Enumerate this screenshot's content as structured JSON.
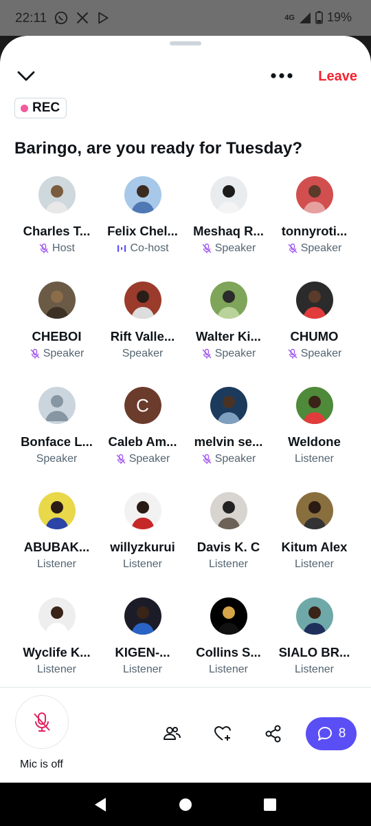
{
  "status_bar": {
    "time": "22:11",
    "network": "4G",
    "battery": "19%"
  },
  "header": {
    "leave_label": "Leave"
  },
  "rec_badge": {
    "label": "REC"
  },
  "space_title": "Baringo, are you ready for Tuesday?",
  "participants": [
    {
      "name": "Charles T...",
      "role": "Host",
      "status": "muted"
    },
    {
      "name": "Felix Chel...",
      "role": "Co-host",
      "status": "speaking"
    },
    {
      "name": "Meshaq R...",
      "role": "Speaker",
      "status": "muted"
    },
    {
      "name": "tonnyroti...",
      "role": "Speaker",
      "status": "muted"
    },
    {
      "name": "CHEBOI",
      "role": "Speaker",
      "status": "muted"
    },
    {
      "name": "Rift Valle...",
      "role": "Speaker",
      "status": "none"
    },
    {
      "name": "Walter Ki...",
      "role": "Speaker",
      "status": "muted"
    },
    {
      "name": "CHUMO",
      "role": "Speaker",
      "status": "muted"
    },
    {
      "name": "Bonface L...",
      "role": "Speaker",
      "status": "none"
    },
    {
      "name": "Caleb Am...",
      "role": "Speaker",
      "status": "muted",
      "avatar_letter": "C"
    },
    {
      "name": "melvin se...",
      "role": "Speaker",
      "status": "muted"
    },
    {
      "name": "Weldone",
      "role": "Listener",
      "status": "none"
    },
    {
      "name": "ABUBAK...",
      "role": "Listener",
      "status": "none"
    },
    {
      "name": "willyzkurui",
      "role": "Listener",
      "status": "none"
    },
    {
      "name": "Davis K. C",
      "role": "Listener",
      "status": "none"
    },
    {
      "name": "Kitum Alex",
      "role": "Listener",
      "status": "none"
    },
    {
      "name": "Wyclife K...",
      "role": "Listener",
      "status": "none"
    },
    {
      "name": "KIGEN-...",
      "role": "Listener",
      "status": "none"
    },
    {
      "name": "Collins S...",
      "role": "Listener",
      "status": "none"
    },
    {
      "name": "SIALO BR...",
      "role": "Listener",
      "status": "none"
    }
  ],
  "bottom_bar": {
    "mic_label": "Mic is off",
    "chat_count": "8"
  },
  "colors": {
    "accent": "#5a4ff5",
    "leave": "#f4212e",
    "rec_dot": "#f25a9b",
    "muted_icon": "#a259f0"
  }
}
